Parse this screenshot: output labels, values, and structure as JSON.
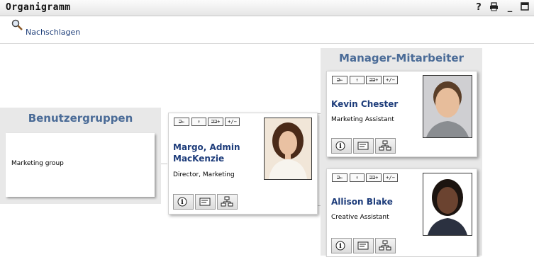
{
  "window": {
    "title": "Organigramm",
    "help_label": "?",
    "print_label": "Drucken",
    "minimize_label": "_"
  },
  "toolbar": {
    "lookup_label": "Nachschlagen"
  },
  "groups_panel": {
    "heading": "Benutzergruppen",
    "group_name": "Marketing group"
  },
  "selected_user": {
    "name_line1": "Margo, Admin",
    "name_line2": "MacKenzie",
    "title": "Director, Marketing"
  },
  "reports_panel": {
    "heading": "Manager-Mitarbeiter",
    "people": [
      {
        "name": "Kevin Chester",
        "title": "Marketing Assistant"
      },
      {
        "name": "Allison Blake",
        "title": "Creative Assistant"
      }
    ]
  },
  "nav_buttons": {
    "back": "⊒←",
    "up": "↑",
    "expand": "⊒⊒+",
    "toggle": "+/−"
  },
  "colors": {
    "heading": "#4a6b97",
    "name": "#1d3c7a",
    "panel_bg": "#e8e8e8"
  }
}
